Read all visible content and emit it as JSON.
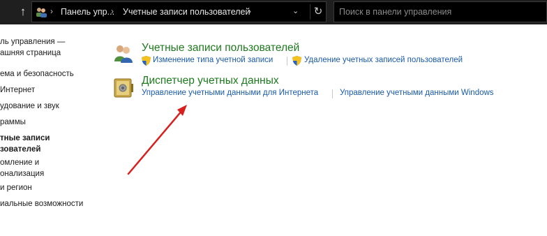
{
  "address_bar": {
    "crumbs": [
      "Панель упр...",
      "Учетные записи пользователей"
    ],
    "search_placeholder": "Поиск в панели управления"
  },
  "sidebar": {
    "items": [
      {
        "label": "ль управления —",
        "active": false
      },
      {
        "label": "ашняя страница",
        "active": false
      },
      {
        "label": "ема и безопасность",
        "active": false
      },
      {
        "label": "Интернет",
        "active": false
      },
      {
        "label": "удование и звук",
        "active": false
      },
      {
        "label": "раммы",
        "active": false
      },
      {
        "label": "тные записи",
        "active": true
      },
      {
        "label": "зователей",
        "active": true
      },
      {
        "label": "омление и",
        "active": false
      },
      {
        "label": "онализация",
        "active": false
      },
      {
        "label": "и регион",
        "active": false
      },
      {
        "label": "иальные возможности",
        "active": false
      }
    ]
  },
  "categories": [
    {
      "title": "Учетные записи пользователей",
      "links": [
        "Изменение типа учетной записи",
        "Удаление учетных записей пользователей"
      ]
    },
    {
      "title": "Диспетчер учетных данных",
      "links": [
        "Управление учетными данными для Интернета",
        "Управление учетными данными Windows"
      ]
    }
  ],
  "colors": {
    "category_title": "#1e7a1e",
    "link": "#1a5aa8",
    "annotation_arrow": "#d91e1e"
  }
}
